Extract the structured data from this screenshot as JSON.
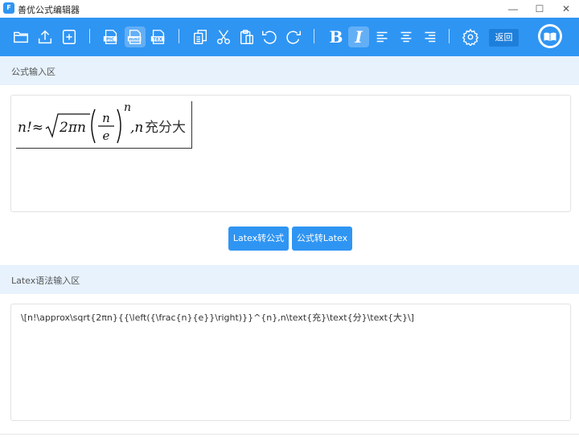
{
  "window": {
    "icon_text": "口",
    "title": "善优公式编辑器",
    "controls": [
      "—",
      "☐",
      "✕"
    ]
  },
  "toolbar": {
    "icons": [
      "open-folder-icon",
      "upload-icon",
      "add-file-icon",
      "export-png-icon",
      "export-mml-icon",
      "export-tex-icon",
      "copy-icon",
      "cut-icon",
      "paste-icon",
      "undo-icon",
      "redo-icon",
      "bold-icon",
      "italic-icon",
      "align-left-icon",
      "align-center-icon",
      "align-right-icon",
      "settings-icon"
    ],
    "file_tags": [
      "PIC",
      "mml",
      "TEX"
    ],
    "bold_label": "B",
    "italic_label": "I",
    "back_label": "返回",
    "brand_color": "#2f95f3"
  },
  "formula_section": {
    "heading": "公式输入区"
  },
  "formula": {
    "lhs": "n!≈",
    "radicand": "2πn",
    "frac_num": "n",
    "frac_den": "e",
    "exponent": "n",
    "tail_var": ",n",
    "tail_text": "充分大"
  },
  "buttons": {
    "latex_to_formula": "Latex转公式",
    "formula_to_latex": "公式转Latex"
  },
  "latex_section": {
    "heading": "Latex语法输入区",
    "value": "\\[n!\\approx\\sqrt{2πn}{{\\left({\\frac{n}{e}}\\right)}}^{n},n\\text{充}\\text{分}\\text{大}\\]"
  },
  "colors": {
    "accent": "#2f95f3",
    "section_bg": "#e7f2fd"
  }
}
